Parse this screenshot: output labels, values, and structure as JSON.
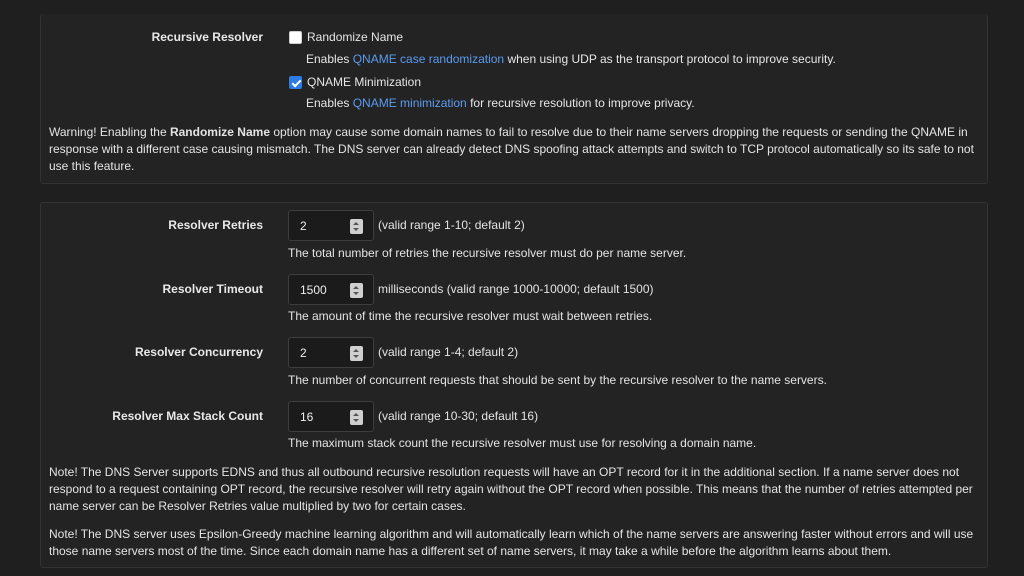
{
  "recursive": {
    "label": "Recursive Resolver",
    "randomize": {
      "checked": false,
      "label": "Randomize Name",
      "desc_pre": "Enables ",
      "desc_link": "QNAME case randomization",
      "desc_post": " when using UDP as the transport protocol to improve security."
    },
    "minimization": {
      "checked": true,
      "label": "QNAME Minimization",
      "desc_pre": "Enables ",
      "desc_link": "QNAME minimization",
      "desc_post": " for recursive resolution to improve privacy."
    },
    "warning_pre": "Warning! Enabling the ",
    "warning_bold": "Randomize Name",
    "warning_post": " option may cause some domain names to fail to resolve due to their name servers dropping the requests or sending the QNAME in response with a different case causing mismatch. The DNS server can already detect DNS spoofing attack attempts and switch to TCP protocol automatically so its safe to not use this feature."
  },
  "resolver": {
    "retries": {
      "label": "Resolver Retries",
      "value": "2",
      "hint": "(valid range 1-10; default 2)",
      "help": "The total number of retries the recursive resolver must do per name server."
    },
    "timeout": {
      "label": "Resolver Timeout",
      "value": "1500",
      "hint": "milliseconds (valid range 1000-10000; default 1500)",
      "help": "The amount of time the recursive resolver must wait between retries."
    },
    "concurrency": {
      "label": "Resolver Concurrency",
      "value": "2",
      "hint": "(valid range 1-4; default 2)",
      "help": "The number of concurrent requests that should be sent by the recursive resolver to the name servers."
    },
    "stack": {
      "label": "Resolver Max Stack Count",
      "value": "16",
      "hint": "(valid range 10-30; default 16)",
      "help": "The maximum stack count the recursive resolver must use for resolving a domain name."
    },
    "note1": "Note! The DNS Server supports EDNS and thus all outbound recursive resolution requests will have an OPT record for it in the additional section. If a name server does not respond to a request containing OPT record, the recursive resolver will retry again without the OPT record when possible. This means that the number of retries attempted per name server can be Resolver Retries value multiplied by two for certain cases.",
    "note2": "Note! The DNS server uses Epsilon-Greedy machine learning algorithm and will automatically learn which of the name servers are answering faster without errors and will use those name servers most of the time. Since each domain name has a different set of name servers, it may take a while before the algorithm learns about them."
  }
}
